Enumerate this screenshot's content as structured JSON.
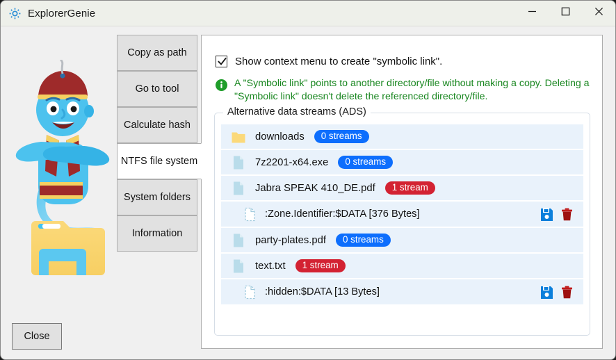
{
  "window": {
    "title": "ExplorerGenie",
    "icon": "gear-icon",
    "caption": {
      "minimize": "—",
      "maximize": "□",
      "close": "✕"
    }
  },
  "mascot": {
    "name": "genie-mascot-illustration"
  },
  "tabs": [
    {
      "label": "Copy as path",
      "selected": false
    },
    {
      "label": "Go to tool",
      "selected": false
    },
    {
      "label": "Calculate hash",
      "selected": false
    },
    {
      "label": "NTFS file system",
      "selected": true
    },
    {
      "label": "System folders",
      "selected": false
    },
    {
      "label": "Information",
      "selected": false
    }
  ],
  "settings": {
    "symlink_checkbox": {
      "label": "Show context menu to create \"symbolic link\".",
      "checked": true
    },
    "info_note": "A \"Symbolic link\" points to another directory/file without making a copy. Deleting a \"Symbolic link\" doesn't delete the referenced directory/file."
  },
  "ads_group": {
    "legend": "Alternative data streams (ADS)",
    "rows": [
      {
        "kind": "folder",
        "name": "downloads",
        "badge": "0 streams",
        "badge_color": "blue",
        "streams": []
      },
      {
        "kind": "file",
        "name": "7z2201-x64.exe",
        "badge": "0 streams",
        "badge_color": "blue",
        "streams": []
      },
      {
        "kind": "file",
        "name": "Jabra SPEAK 410_DE.pdf",
        "badge": "1 stream",
        "badge_color": "red",
        "streams": [
          {
            "name": ":Zone.Identifier:$DATA [376 Bytes]",
            "save_label": "save-icon",
            "delete_label": "delete-icon"
          }
        ]
      },
      {
        "kind": "file",
        "name": "party-plates.pdf",
        "badge": "0 streams",
        "badge_color": "blue",
        "streams": []
      },
      {
        "kind": "file",
        "name": "text.txt",
        "badge": "1 stream",
        "badge_color": "red",
        "streams": [
          {
            "name": ":hidden:$DATA [13 Bytes]",
            "save_label": "save-icon",
            "delete_label": "delete-icon"
          }
        ]
      }
    ]
  },
  "footer": {
    "close_label": "Close"
  },
  "colors": {
    "badge_blue": "#0d6efd",
    "badge_red": "#d32232",
    "info_green": "#18861f",
    "row_tint": "#e9f2fb",
    "accent_blue": "#0b7fdb"
  }
}
